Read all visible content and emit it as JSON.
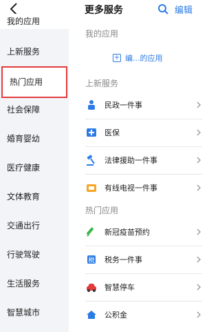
{
  "header": {
    "title": "更多服务",
    "edit_label": "编辑"
  },
  "sidebar": {
    "items": [
      {
        "label": "我的应用"
      },
      {
        "label": "上新服务"
      },
      {
        "label": "热门应用"
      },
      {
        "label": "社会保障"
      },
      {
        "label": "婚育婴幼"
      },
      {
        "label": "医疗健康"
      },
      {
        "label": "文体教育"
      },
      {
        "label": "交通出行"
      },
      {
        "label": "行驶驾驶"
      },
      {
        "label": "生活服务"
      },
      {
        "label": "智慧城市"
      }
    ]
  },
  "main": {
    "my_apps": {
      "title": "我的应用",
      "add_label": "编...的应用"
    },
    "new_services": {
      "title": "上新服务",
      "items": [
        {
          "label": "民政一件事",
          "icon": "civil-affairs-icon",
          "color": "#2c7be5"
        },
        {
          "label": "医保",
          "icon": "medical-insurance-icon",
          "color": "#2c7be5"
        },
        {
          "label": "法律援助一件事",
          "icon": "gavel-icon",
          "color": "#2c7be5"
        },
        {
          "label": "有线电视一件事",
          "icon": "tv-icon",
          "color": "#f5a623"
        }
      ]
    },
    "hot_apps": {
      "title": "热门应用",
      "items": [
        {
          "label": "新冠疫苗预约",
          "icon": "vaccine-icon",
          "color": "#3bb54a"
        },
        {
          "label": "税务一件事",
          "icon": "tax-icon",
          "color": "#2c7be5"
        },
        {
          "label": "智慧停车",
          "icon": "car-icon",
          "color": "#e23b3b"
        },
        {
          "label": "公积金",
          "icon": "housing-fund-icon",
          "color": "#2c7be5"
        }
      ]
    }
  }
}
